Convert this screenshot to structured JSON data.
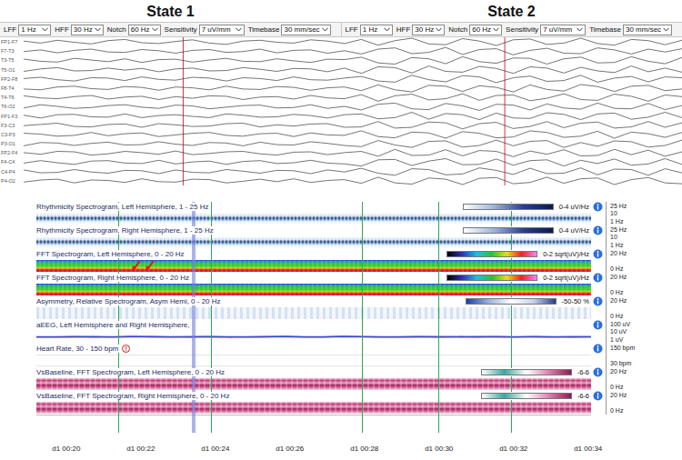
{
  "states": [
    {
      "title": "State 1"
    },
    {
      "title": "State 2"
    }
  ],
  "toolbars": [
    {
      "controls": [
        {
          "label": "LFF",
          "value": "1 Hz"
        },
        {
          "label": "HFF",
          "value": "30 Hz"
        },
        {
          "label": "Notch",
          "value": "60 Hz"
        },
        {
          "label": "Sensitivity",
          "value": "7 uV/mm"
        },
        {
          "label": "Timebase",
          "value": "30 mm/sec"
        }
      ]
    },
    {
      "controls": [
        {
          "label": "LFF",
          "value": "1 Hz"
        },
        {
          "label": "HFF",
          "value": "30 Hz"
        },
        {
          "label": "Notch",
          "value": "60 Hz"
        },
        {
          "label": "Sensitivity",
          "value": "7 uV/mm"
        },
        {
          "label": "Timebase",
          "value": "30 mm/sec"
        }
      ]
    }
  ],
  "eeg": {
    "cursors": [
      {
        "sample": 9.45
      },
      {
        "sample": 28.5
      }
    ],
    "channels": [
      {
        "label": "FP1-F7",
        "values": [
          2,
          -3,
          4,
          -1,
          -5,
          3,
          6,
          -2,
          -4,
          1,
          5,
          -3,
          -6,
          2,
          4,
          -1,
          -3,
          5,
          2,
          -4,
          6,
          -8,
          3,
          9,
          -5,
          -7,
          8,
          2,
          -9,
          5,
          7,
          -6,
          -3,
          9,
          -4,
          -8,
          6,
          3,
          -7,
          4
        ]
      },
      {
        "label": "F7-T3",
        "values": [
          -1,
          3,
          -4,
          2,
          5,
          -2,
          -3,
          4,
          1,
          -5,
          2,
          4,
          -3,
          -1,
          5,
          -4,
          2,
          3,
          -5,
          1,
          -7,
          5,
          8,
          -6,
          -3,
          9,
          -8,
          4,
          6,
          -9,
          2,
          7,
          -5,
          -6,
          8,
          3,
          -7,
          5,
          -2,
          6
        ]
      },
      {
        "label": "T3-T5",
        "values": [
          3,
          -2,
          -4,
          5,
          1,
          -3,
          4,
          -5,
          2,
          3,
          -4,
          1,
          5,
          -2,
          -3,
          4,
          -1,
          -5,
          3,
          2,
          8,
          -6,
          -9,
          7,
          4,
          -8,
          9,
          -3,
          -7,
          6,
          5,
          -9,
          4,
          8,
          -6,
          -5,
          9,
          -2,
          -8,
          7
        ]
      },
      {
        "label": "T5-O1",
        "values": [
          -4,
          2,
          5,
          -3,
          -2,
          4,
          -1,
          3,
          -5,
          2,
          4,
          -3,
          -2,
          5,
          1,
          -4,
          3,
          2,
          -5,
          4,
          -9,
          7,
          5,
          -8,
          9,
          -4,
          -6,
          8,
          3,
          -9,
          7,
          4,
          -8,
          6,
          -3,
          -7,
          9,
          -5,
          4,
          -6
        ]
      },
      {
        "label": "FP2-F8",
        "values": [
          1,
          4,
          -2,
          -5,
          3,
          2,
          -4,
          5,
          -1,
          -3,
          4,
          2,
          -5,
          3,
          1,
          -4,
          5,
          -2,
          -3,
          2,
          6,
          -5,
          -8,
          9,
          -2,
          -7,
          8,
          5,
          -9,
          3,
          7,
          -6,
          -4,
          9,
          -8,
          2,
          6,
          -7,
          5,
          3
        ]
      },
      {
        "label": "F8-T4",
        "values": [
          -2,
          -4,
          3,
          5,
          -1,
          -3,
          4,
          2,
          -5,
          3,
          1,
          -4,
          5,
          -2,
          -3,
          4,
          2,
          -5,
          1,
          3,
          -6,
          8,
          -4,
          -9,
          7,
          5,
          -8,
          6,
          2,
          -9,
          8,
          -3,
          -7,
          9,
          4,
          -8,
          5,
          7,
          -6,
          -2
        ]
      },
      {
        "label": "T4-T6",
        "values": [
          4,
          -1,
          -3,
          2,
          5,
          -4,
          1,
          3,
          -5,
          2,
          -2,
          4,
          3,
          -5,
          1,
          2,
          -4,
          5,
          -1,
          -3,
          7,
          -9,
          4,
          8,
          -6,
          -3,
          9,
          -7,
          5,
          6,
          -8,
          -2,
          9,
          -5,
          -7,
          8,
          3,
          -9,
          6,
          2
        ]
      },
      {
        "label": "T6-O2",
        "values": [
          -3,
          5,
          1,
          -4,
          -2,
          3,
          5,
          -1,
          -4,
          4,
          2,
          -5,
          -1,
          3,
          4,
          -3,
          -2,
          5,
          -4,
          1,
          -8,
          6,
          9,
          -5,
          -7,
          8,
          2,
          -9,
          6,
          4,
          -8,
          7,
          -3,
          -6,
          9,
          -4,
          -5,
          8,
          -7,
          3
        ]
      },
      {
        "label": "FP1-F3",
        "values": [
          2,
          -5,
          3,
          4,
          -2,
          -3,
          5,
          -4,
          1,
          3,
          -1,
          -4,
          5,
          2,
          -3,
          -2,
          4,
          1,
          -5,
          3,
          5,
          -7,
          -4,
          9,
          -8,
          6,
          3,
          -9,
          7,
          -5,
          -6,
          8,
          4,
          -9,
          5,
          7,
          -8,
          -3,
          9,
          -4
        ]
      },
      {
        "label": "F3-C3",
        "values": [
          -1,
          2,
          5,
          -3,
          -4,
          2,
          3,
          -5,
          4,
          1,
          -3,
          -2,
          4,
          5,
          -4,
          1,
          -2,
          3,
          4,
          -5,
          -4,
          9,
          -7,
          -5,
          8,
          6,
          -9,
          4,
          7,
          -8,
          -3,
          9,
          -6,
          5,
          8,
          -7,
          -4,
          9,
          -5,
          6
        ]
      },
      {
        "label": "C3-P3",
        "values": [
          3,
          1,
          -4,
          -2,
          5,
          -3,
          2,
          4,
          -5,
          -1,
          3,
          5,
          -2,
          -4,
          2,
          3,
          -5,
          4,
          -1,
          -2,
          9,
          -5,
          -8,
          6,
          4,
          -9,
          7,
          3,
          -8,
          -6,
          9,
          5,
          -7,
          -4,
          8,
          -9,
          6,
          2,
          -7,
          5
        ]
      },
      {
        "label": "P3-O1",
        "values": [
          -5,
          3,
          2,
          -4,
          1,
          4,
          -3,
          -2,
          5,
          -1,
          -4,
          3,
          2,
          -5,
          4,
          -2,
          -3,
          5,
          1,
          -4,
          -7,
          8,
          -3,
          -9,
          6,
          7,
          -8,
          -4,
          9,
          -5,
          6,
          8,
          -9,
          3,
          -6,
          7,
          5,
          -8,
          -4,
          9
        ]
      },
      {
        "label": "FP2-F4",
        "values": [
          1,
          -3,
          4,
          3,
          -5,
          -2,
          4,
          1,
          -3,
          5,
          -4,
          -1,
          3,
          4,
          -2,
          -5,
          2,
          3,
          -4,
          1,
          4,
          -8,
          9,
          -6,
          -5,
          8,
          -7,
          6,
          4,
          -9,
          5,
          -3,
          8,
          -7,
          -6,
          9,
          -4,
          7,
          -8,
          3
        ]
      },
      {
        "label": "F4-C4",
        "values": [
          -2,
          4,
          -1,
          -5,
          3,
          4,
          -2,
          -3,
          5,
          -4,
          1,
          3,
          -5,
          2,
          4,
          -3,
          -1,
          5,
          -2,
          -4,
          -9,
          6,
          7,
          -8,
          3,
          9,
          -6,
          -5,
          8,
          -7,
          4,
          6,
          -9,
          5,
          -3,
          8,
          -7,
          -4,
          9,
          -5
        ]
      },
      {
        "label": "C4-P4",
        "values": [
          4,
          -3,
          -2,
          5,
          -1,
          -4,
          3,
          2,
          -5,
          4,
          -2,
          -3,
          5,
          1,
          -4,
          3,
          2,
          -5,
          4,
          -1,
          8,
          -4,
          -9,
          7,
          5,
          -8,
          -6,
          9,
          3,
          -7,
          8,
          -5,
          -4,
          9,
          -8,
          6,
          5,
          -9,
          7,
          -3
        ]
      },
      {
        "label": "P4-O2",
        "values": [
          -3,
          2,
          4,
          -5,
          2,
          1,
          -4,
          5,
          -2,
          -3,
          4,
          3,
          -5,
          -1,
          4,
          -2,
          5,
          -4,
          1,
          3,
          -6,
          9,
          -5,
          -8,
          7,
          4,
          -9,
          6,
          8,
          -7,
          -4,
          9,
          -6,
          5,
          7,
          -9,
          3,
          8,
          -5,
          -7
        ]
      }
    ]
  },
  "trends": {
    "rows": [
      {
        "title": "Rhythmicity Spectrogram, Left Hemisphere, 1 - 25 Hz",
        "kind": "rhythmicity",
        "legend": "0-4 uV/Hz",
        "ticks": [
          "25 Hz",
          "10",
          "1 Hz"
        ],
        "arrows": []
      },
      {
        "title": "Rhythmicity Spectrogram, Right Hemisphere, 1 - 25 Hz",
        "kind": "rhythmicity",
        "legend": "0-4 uV/Hz",
        "ticks": [
          "25 Hz",
          "10",
          "1 Hz"
        ],
        "arrows": []
      },
      {
        "title": "FFT Spectrogram, Left Hemisphere, 0 - 20 Hz",
        "kind": "fft",
        "legend": "0-2 sqrt(uV)/Hz",
        "ticks": [
          "20 Hz",
          "0 Hz"
        ],
        "arrows": [
          {
            "time": 21.88
          },
          {
            "time": 22.25
          }
        ]
      },
      {
        "title": "FFT Spectrogram, Right Hemisphere, 0 - 20 Hz",
        "kind": "fft",
        "legend": "0-2 sqrt(uV)/Hz",
        "ticks": [
          "20 Hz",
          "0 Hz"
        ],
        "arrows": []
      },
      {
        "title": "Asymmetry, Relative Spectrogram, Asym Hemi, 0 - 20 Hz",
        "kind": "asym",
        "legend": "-50-50 %",
        "ticks": [
          "20 Hz",
          "0 Hz"
        ],
        "arrows": []
      },
      {
        "title": "aEEG, Left Hemisphere and Right Hemisphere,",
        "kind": "aeeg",
        "ticks": [
          "100 uV",
          "10 uV",
          "1 uV"
        ],
        "arrows": []
      },
      {
        "title": "Heart Rate, 30 - 150 bpm",
        "kind": "hr",
        "alert": "!",
        "ticks": [
          "150 bpm",
          "30 bpm"
        ],
        "arrows": []
      },
      {
        "title": "VsBaseline, FFT Spectrogram, Left Hemisphere, 0 - 20 Hz",
        "kind": "vsbaseline",
        "legend": "-6-6",
        "ticks": [
          "20 Hz",
          "0 Hz"
        ],
        "arrows": []
      },
      {
        "title": "VsBaseline, FFT Spectrogram, Right Hemisphere, 0 - 20 Hz",
        "kind": "vsbaseline",
        "legend": "-6-6",
        "ticks": [
          "20 Hz",
          "0 Hz"
        ],
        "arrows": []
      }
    ],
    "aeeg_series": [
      {
        "name": "Left Hemisphere",
        "color": "#d0308a",
        "values": [
          9,
          10,
          11,
          9,
          10,
          12,
          10,
          9,
          11,
          10,
          9,
          10,
          11,
          10,
          9,
          10,
          12,
          11,
          10,
          9,
          10,
          11,
          10,
          9,
          11,
          10,
          10,
          9,
          11,
          10
        ]
      },
      {
        "name": "Right Hemisphere",
        "color": "#3050d0",
        "values": [
          10,
          9,
          10,
          11,
          9,
          10,
          11,
          10,
          9,
          11,
          10,
          9,
          10,
          12,
          10,
          9,
          11,
          10,
          9,
          10,
          11,
          9,
          10,
          11,
          10,
          9,
          11,
          10,
          9,
          10
        ]
      }
    ],
    "markers": [
      {
        "time": 21.4,
        "kind": "event",
        "color": "#2fa84f"
      },
      {
        "time": 23.42,
        "kind": "cursor",
        "color": "#7080e0"
      },
      {
        "time": 23.88,
        "kind": "event",
        "color": "#2fa84f"
      },
      {
        "time": 27.93,
        "kind": "event",
        "color": "#2fa84f"
      },
      {
        "time": 29.98,
        "kind": "event",
        "color": "#2fa84f"
      },
      {
        "time": 31.93,
        "kind": "event",
        "color": "#2fa84f"
      }
    ],
    "time_axis": {
      "min": 19.2,
      "max": 34.08,
      "ticks": [
        {
          "label": "d1 00:20",
          "time": 20
        },
        {
          "label": "d1 00:22",
          "time": 22
        },
        {
          "label": "d1 00:24",
          "time": 24
        },
        {
          "label": "d1 00:26",
          "time": 26
        },
        {
          "label": "d1 00:28",
          "time": 28
        },
        {
          "label": "d1 00:30",
          "time": 30
        },
        {
          "label": "d1 00:32",
          "time": 32
        },
        {
          "label": "d1 00:34",
          "time": 34
        }
      ]
    }
  }
}
